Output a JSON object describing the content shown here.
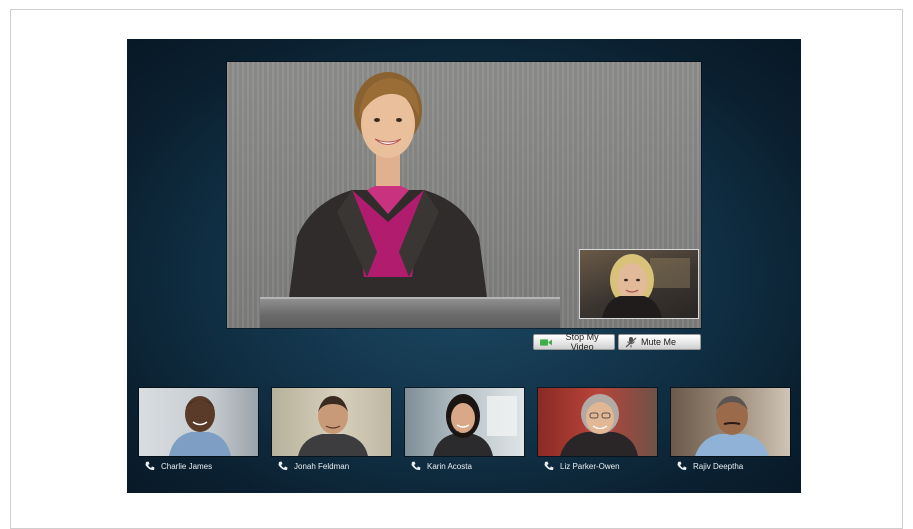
{
  "controls": {
    "stop_video_label": "Stop My Video",
    "mute_label": "Mute Me"
  },
  "participants": [
    {
      "name": "Charlie James"
    },
    {
      "name": "Jonah Feldman"
    },
    {
      "name": "Karin Acosta"
    },
    {
      "name": "Liz Parker-Owen"
    },
    {
      "name": "Rajiv Deeptha"
    }
  ],
  "icons": {
    "camera": "camera-icon",
    "mic": "microphone-muted-icon",
    "phone": "phone-icon"
  },
  "colors": {
    "stage_bg": "#123349",
    "camera_green": "#3fae49",
    "label_text": "#e9eef2"
  }
}
